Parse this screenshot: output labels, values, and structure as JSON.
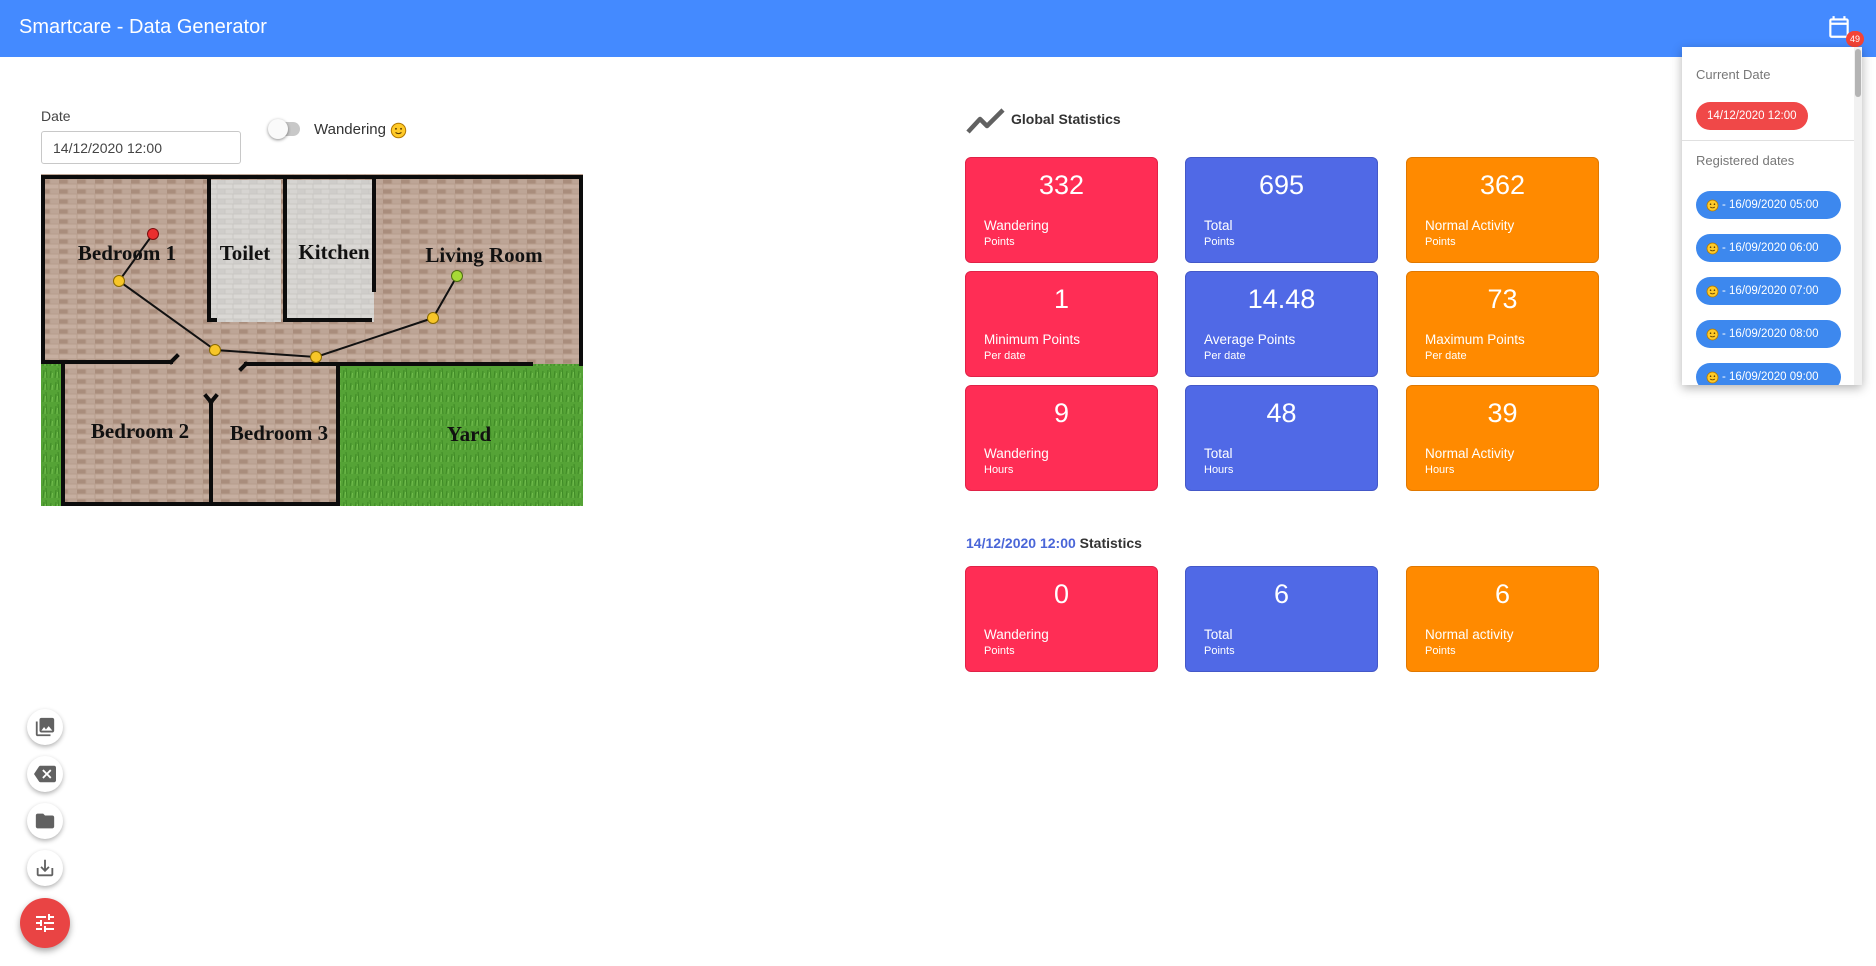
{
  "app": {
    "title": "Smartcare - Data Generator",
    "notification_count": "49"
  },
  "form": {
    "date_label": "Date",
    "date_value": "14/12/2020 12:00",
    "wandering_label": "Wandering",
    "wandering_enabled": false
  },
  "floorplan": {
    "rooms": [
      "Bedroom 1",
      "Toilet",
      "Kitchen",
      "Living Room",
      "Bedroom 2",
      "Bedroom 3",
      "Yard"
    ]
  },
  "global_stats": {
    "title": "Global Statistics",
    "cards": [
      {
        "value": "332",
        "label": "Wandering",
        "sub": "Points",
        "color": "red"
      },
      {
        "value": "695",
        "label": "Total",
        "sub": "Points",
        "color": "blue"
      },
      {
        "value": "362",
        "label": "Normal Activity",
        "sub": "Points",
        "color": "orange"
      },
      {
        "value": "1",
        "label": "Minimum Points",
        "sub": "Per date",
        "color": "red"
      },
      {
        "value": "14.48",
        "label": "Average Points",
        "sub": "Per date",
        "color": "blue"
      },
      {
        "value": "73",
        "label": "Maximum Points",
        "sub": "Per date",
        "color": "orange"
      },
      {
        "value": "9",
        "label": "Wandering",
        "sub": "Hours",
        "color": "red"
      },
      {
        "value": "48",
        "label": "Total",
        "sub": "Hours",
        "color": "blue"
      },
      {
        "value": "39",
        "label": "Normal Activity",
        "sub": "Hours",
        "color": "orange"
      }
    ]
  },
  "date_stats": {
    "date": "14/12/2020 12:00",
    "title": "Statistics",
    "cards": [
      {
        "value": "0",
        "label": "Wandering",
        "sub": "Points",
        "color": "red"
      },
      {
        "value": "6",
        "label": "Total",
        "sub": "Points",
        "color": "blue"
      },
      {
        "value": "6",
        "label": "Normal activity",
        "sub": "Points",
        "color": "orange"
      }
    ]
  },
  "date_panel": {
    "current_heading": "Current Date",
    "current_date": "14/12/2020 12:00",
    "registered_heading": "Registered dates",
    "dates": [
      "- 16/09/2020 05:00",
      "- 16/09/2020 06:00",
      "- 16/09/2020 07:00",
      "- 16/09/2020 08:00",
      "- 16/09/2020 09:00"
    ]
  },
  "colors": {
    "header": "#448aff",
    "red": "#ff2d55",
    "blue": "#5069e6",
    "orange": "#ff8a00",
    "fab": "#e94444",
    "chip_current": "#f04848",
    "chip_date": "#3d88ee"
  },
  "icons": {
    "header": "calendar-icon",
    "stats": "trending-up-icon",
    "fabs": [
      "image-icon",
      "backspace-icon",
      "folder-icon",
      "download-icon",
      "tune-icon"
    ],
    "wandering": "slightly-smiling-face"
  }
}
